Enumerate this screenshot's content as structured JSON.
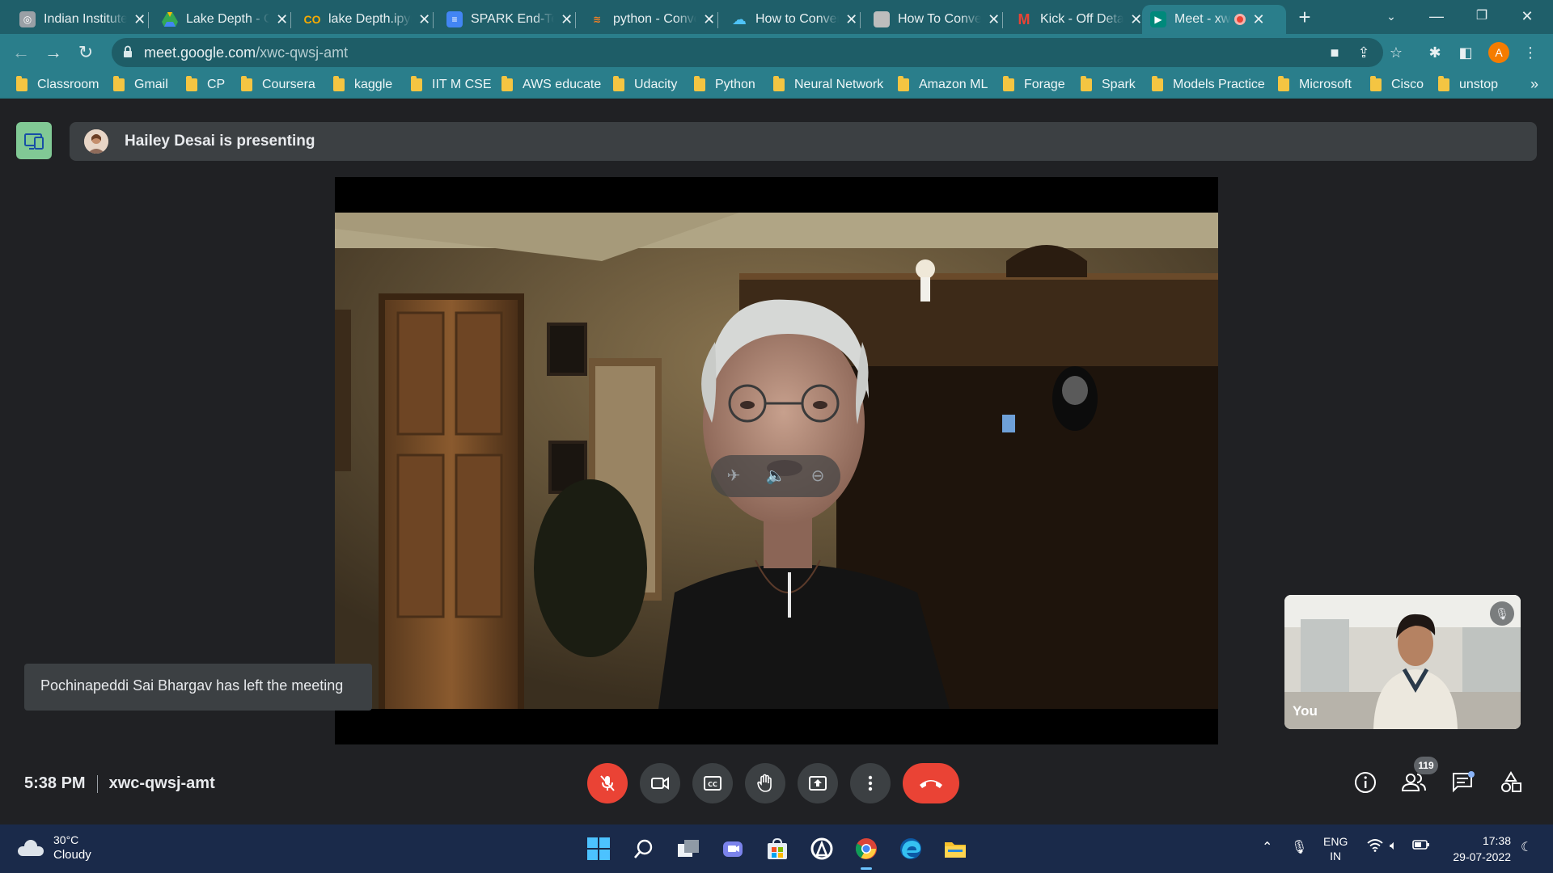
{
  "browser": {
    "tabs": [
      {
        "title": "Indian Institute",
        "favicon": "globe-icon",
        "color": "#9aa0a6"
      },
      {
        "title": "Lake Depth - Google Drive",
        "favicon": "drive-icon",
        "color": "#34a853"
      },
      {
        "title": "lake Depth.ipynb",
        "favicon": "colab-icon",
        "color": "#f9ab00"
      },
      {
        "title": "SPARK End-Term",
        "favicon": "docs-icon",
        "color": "#4285f4"
      },
      {
        "title": "python - Convert",
        "favicon": "stackoverflow-icon",
        "color": "#f48024"
      },
      {
        "title": "How to Convert",
        "favicon": "cloud-icon",
        "color": "#4fc3f7"
      },
      {
        "title": "How To Convert",
        "favicon": "page-icon",
        "color": "#bdbdbd"
      },
      {
        "title": "Kick - Off Details",
        "favicon": "gmail-icon",
        "color": "#ea4335"
      },
      {
        "title": "Meet - xwc-qwsj-amt",
        "favicon": "meet-icon",
        "color": "#00897b",
        "active": true
      }
    ],
    "url_host": "meet.google.com",
    "url_path": "/xwc-qwsj-amt",
    "profile_initial": "A",
    "bookmarks": [
      "Classroom",
      "Gmail",
      "CP",
      "Coursera",
      "kaggle",
      "IIT M CSE",
      "AWS educate",
      "Udacity",
      "Python",
      "Neural Network",
      "Amazon ML",
      "Forage",
      "Spark",
      "Models Practice",
      "Microsoft",
      "Cisco",
      "unstop"
    ]
  },
  "meet": {
    "presenting_text": "Hailey Desai is presenting",
    "toast": "Pochinapeddi Sai Bhargav has left the meeting",
    "self_label": "You",
    "time": "5:38 PM",
    "meeting_code": "xwc-qwsj-amt",
    "participants_count": "119"
  },
  "taskbar": {
    "temperature": "30°C",
    "weather": "Cloudy",
    "lang_top": "ENG",
    "lang_bottom": "IN",
    "clock_time": "17:38",
    "clock_date": "29-07-2022"
  }
}
